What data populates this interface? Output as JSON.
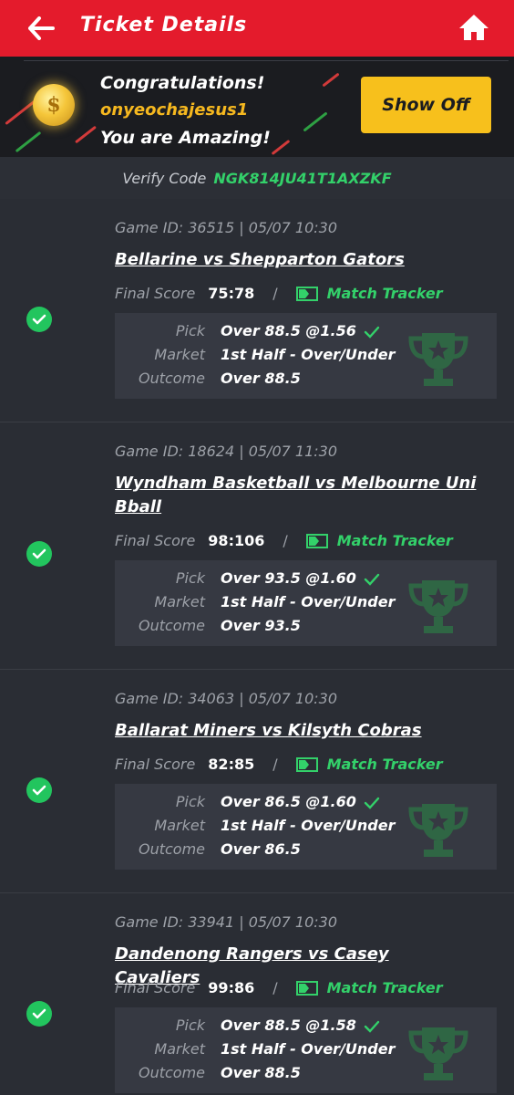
{
  "header": {
    "title": "Ticket Details"
  },
  "banner": {
    "congrats": "Congratulations!",
    "username": "onyeochajesus1",
    "amazing": "You are Amazing!",
    "show_off": "Show Off"
  },
  "verify": {
    "label": "Verify Code",
    "code": "NGK814JU41T1AXZKF"
  },
  "labels": {
    "final_score": "Final Score",
    "separator": "/",
    "match_tracker": "Match Tracker",
    "pick": "Pick",
    "market": "Market",
    "outcome": "Outcome"
  },
  "tickets": [
    {
      "game_id": "Game ID: 36515 | 05/07 10:30",
      "match": "Bellarine vs Shepparton Gators",
      "score": "75:78",
      "pick": "Over 88.5 @1.56",
      "market": "1st Half - Over/Under",
      "outcome": "Over 88.5"
    },
    {
      "game_id": "Game ID: 18624 | 05/07 11:30",
      "match": "Wyndham Basketball vs Melbourne Uni Bball",
      "score": "98:106",
      "pick": "Over 93.5 @1.60",
      "market": "1st Half - Over/Under",
      "outcome": "Over 93.5"
    },
    {
      "game_id": "Game ID: 34063 | 05/07 10:30",
      "match": "Ballarat Miners vs Kilsyth Cobras",
      "score": "82:85",
      "pick": "Over 86.5 @1.60",
      "market": "1st Half - Over/Under",
      "outcome": "Over 86.5"
    },
    {
      "game_id": "Game ID: 33941 | 05/07 10:30",
      "match": "Dandenong Rangers vs Casey Cavaliers",
      "score": "99:86",
      "pick": "Over 88.5 @1.58",
      "market": "1st Half - Over/Under",
      "outcome": "Over 88.5"
    }
  ],
  "colors": {
    "accent_red": "#e41b2c",
    "success_green": "#33d16a",
    "gold": "#f7c01c"
  }
}
